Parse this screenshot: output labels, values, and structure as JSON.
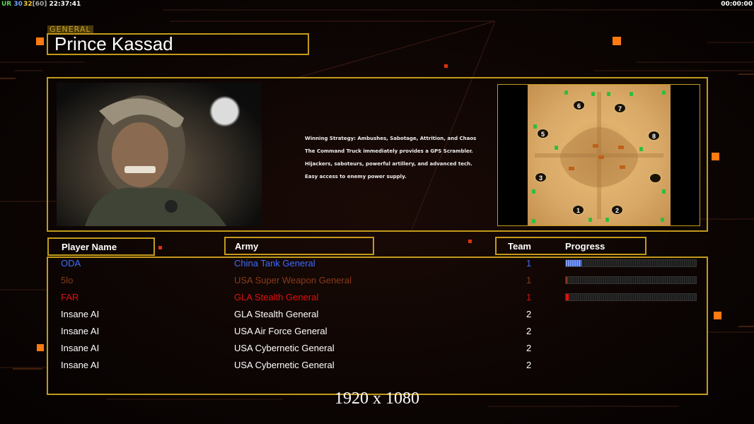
{
  "hud": {
    "left_prefix": "UR",
    "left_a": "30",
    "left_b": "32",
    "left_c": "[60]",
    "left_time": "22:37:41",
    "right_time": "00:00:00"
  },
  "general": {
    "tag": "GENERAL",
    "name": "Prince Kassad"
  },
  "strategy": [
    "Winning Strategy: Ambushes, Sabotage, Attrition, and Chaos",
    "The Command Truck immediately provides a GPS Scrambler.",
    "Hijackers, saboteurs, powerful artillery, and advanced tech.",
    "Easy access to enemy power supply."
  ],
  "minimap": {
    "slots": [
      "6",
      "7",
      "5",
      "8",
      "3",
      "",
      "1",
      "2"
    ]
  },
  "headers": {
    "player": "Player Name",
    "army": "Army",
    "team": "Team",
    "progress": "Progress"
  },
  "players": [
    {
      "name": "ODA",
      "army": "China Tank General",
      "team": "1",
      "color": "#3f6cff",
      "progress": 0.12
    },
    {
      "name": "5lo",
      "army": "USA Super Weapon General",
      "team": "1",
      "color": "#8a3a1a",
      "progress": 0.01
    },
    {
      "name": "FAR",
      "army": "GLA Stealth General",
      "team": "1",
      "color": "#e01010",
      "progress": 0.02
    },
    {
      "name": "Insane AI",
      "army": "GLA Stealth General",
      "team": "2",
      "color": "#ffffff"
    },
    {
      "name": "Insane AI",
      "army": "USA Air Force General",
      "team": "2",
      "color": "#ffffff"
    },
    {
      "name": "Insane AI",
      "army": "USA Cybernetic General",
      "team": "2",
      "color": "#ffffff"
    },
    {
      "name": "Insane AI",
      "army": "USA Cybernetic General",
      "team": "2",
      "color": "#ffffff"
    }
  ],
  "resolution": "1920 x 1080",
  "colors": {
    "gold": "#c29a1b",
    "accent": "#ff7a10",
    "blue": "#3f6cff",
    "red": "#e01010"
  }
}
